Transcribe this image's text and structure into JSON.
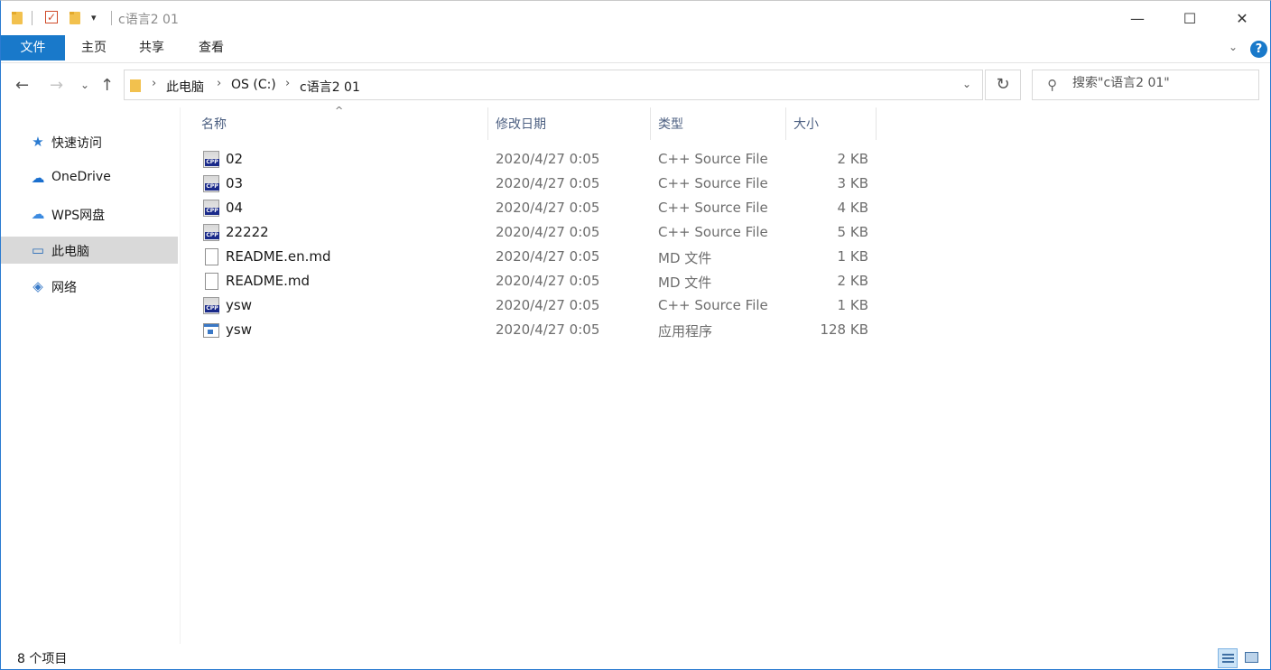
{
  "window": {
    "title": "c语言2 01",
    "controls": {
      "minimize": "—",
      "maximize": "☐",
      "close": "✕"
    }
  },
  "ribbon": {
    "tabs": [
      "文件",
      "主页",
      "共享",
      "查看"
    ],
    "help": "?"
  },
  "address": {
    "crumbs": [
      "此电脑",
      "OS (C:)",
      "c语言2 01"
    ]
  },
  "search": {
    "placeholder": "搜索\"c语言2 01\""
  },
  "sidebar": {
    "items": [
      {
        "label": "快速访问",
        "icon": "star-icon"
      },
      {
        "label": "OneDrive",
        "icon": "cloud-icon"
      },
      {
        "label": "WPS网盘",
        "icon": "cloud-outline-icon"
      },
      {
        "label": "此电脑",
        "icon": "computer-icon",
        "selected": true
      },
      {
        "label": "网络",
        "icon": "network-icon"
      }
    ]
  },
  "columns": {
    "name": "名称",
    "date": "修改日期",
    "type": "类型",
    "size": "大小"
  },
  "files": [
    {
      "name": "02",
      "date": "2020/4/27 0:05",
      "type": "C++ Source File",
      "size": "2 KB",
      "icon": "cpp"
    },
    {
      "name": "03",
      "date": "2020/4/27 0:05",
      "type": "C++ Source File",
      "size": "3 KB",
      "icon": "cpp"
    },
    {
      "name": "04",
      "date": "2020/4/27 0:05",
      "type": "C++ Source File",
      "size": "4 KB",
      "icon": "cpp"
    },
    {
      "name": "22222",
      "date": "2020/4/27 0:05",
      "type": "C++ Source File",
      "size": "5 KB",
      "icon": "cpp"
    },
    {
      "name": "README.en.md",
      "date": "2020/4/27 0:05",
      "type": "MD 文件",
      "size": "1 KB",
      "icon": "md"
    },
    {
      "name": "README.md",
      "date": "2020/4/27 0:05",
      "type": "MD 文件",
      "size": "2 KB",
      "icon": "md"
    },
    {
      "name": "ysw",
      "date": "2020/4/27 0:05",
      "type": "C++ Source File",
      "size": "1 KB",
      "icon": "cpp"
    },
    {
      "name": "ysw",
      "date": "2020/4/27 0:05",
      "type": "应用程序",
      "size": "128 KB",
      "icon": "exe"
    }
  ],
  "status": {
    "count_text": "8 个项目"
  },
  "colors": {
    "accent": "#1979ca",
    "selected": "#d9d9d9",
    "header_text": "#4d6082"
  }
}
